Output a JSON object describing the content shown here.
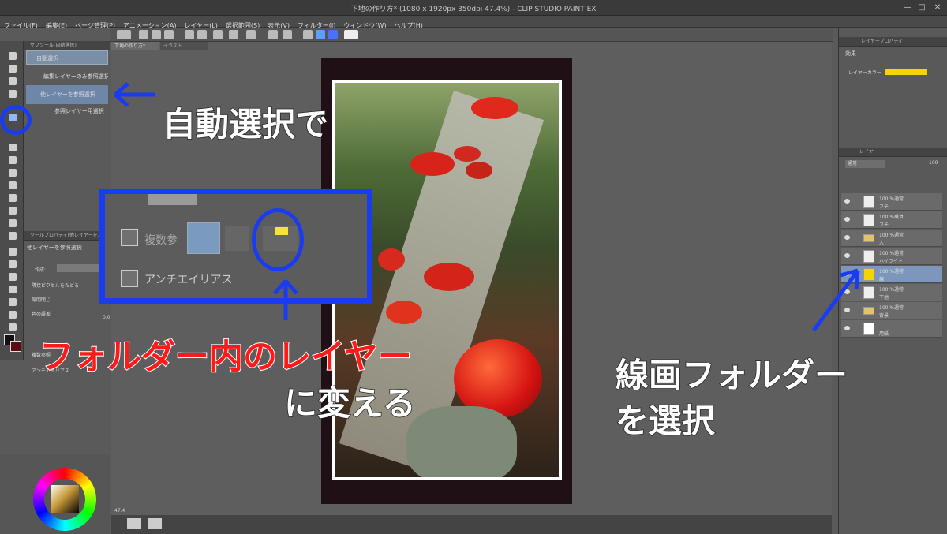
{
  "window": {
    "title": "下地の作り方* (1080 x 1920px 350dpi 47.4%) - CLIP STUDIO PAINT EX",
    "minimize": "—",
    "maximize": "□",
    "close": "✕"
  },
  "menu": [
    "ファイル(F)",
    "編集(E)",
    "ページ管理(P)",
    "アニメーション(A)",
    "レイヤー(L)",
    "選択範囲(S)",
    "表示(V)",
    "フィルター(I)",
    "ウィンドウ(W)",
    "ヘルプ(H)"
  ],
  "tabs": {
    "canvas1": "下地の作り方*",
    "canvas2": "イラスト"
  },
  "subtool": {
    "header": "サブツール[自動選択]",
    "group": "自動選択",
    "items": [
      "編集レイヤーのみ参照選択",
      "他レイヤーを参照選択",
      "参照レイヤー用選択"
    ]
  },
  "toolprop": {
    "header": "ツールプロパティ[他レイヤーを…",
    "title": "他レイヤーを参照選択",
    "operation": "作成:",
    "opt1": "隣接ピクセルをたどる",
    "opt2": "隙間閉じ",
    "color_margin": "色の誤差",
    "color_margin_value": "0.0",
    "opt3": "複数参照",
    "opt4": "アンチエイリアス"
  },
  "zoom_panel": {
    "multi_ref": "複数参",
    "antialias": "アンチエイリアス"
  },
  "canvas": {
    "zoom": "47.4"
  },
  "right": {
    "prop_header": "レイヤープロパティ",
    "effect": "効果",
    "layer_color": "レイヤーカラー",
    "layer_tab": "レイヤー",
    "blend": "通常",
    "opacity": "100",
    "layers": [
      {
        "mode": "100 %通常",
        "name": "フチ"
      },
      {
        "mode": "100 %乗算",
        "name": "フチ"
      },
      {
        "mode": "100 %通常",
        "name": "人"
      },
      {
        "mode": "100 %通常",
        "name": "ハイライト"
      },
      {
        "mode": "100 %通常",
        "name": "線"
      },
      {
        "mode": "100 %通常",
        "name": "下地"
      },
      {
        "mode": "100 %通常",
        "name": "背景"
      },
      {
        "mode": "",
        "name": "用紙"
      }
    ]
  },
  "captions": {
    "auto_select": "自動選択で",
    "folder_layer": "フォルダー内のレイヤー",
    "change": "に変える",
    "line_folder": "線画フォルダー",
    "select": "を選択"
  },
  "colors": {
    "accent_blue": "#1a3cf0",
    "caption_red": "#ff1a1a",
    "layer_color": "#f5d400"
  }
}
